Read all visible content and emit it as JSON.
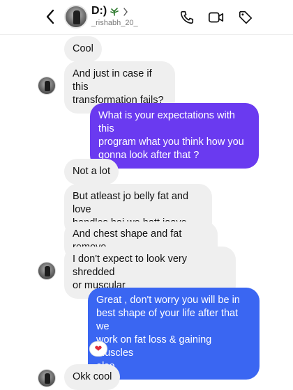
{
  "header": {
    "name": "D:)",
    "username": "_rishabh_20_"
  },
  "messages": [
    {
      "id": "m1",
      "from": "them",
      "text": "Cool"
    },
    {
      "id": "m2",
      "from": "them",
      "text": "And just in case if this\ntransformation fails?"
    },
    {
      "id": "m3",
      "from": "me",
      "text": "What is your expectations with this\nprogram what you think how you\ngonna look after that ?"
    },
    {
      "id": "m4",
      "from": "them",
      "text": "Not a lot"
    },
    {
      "id": "m5",
      "from": "them",
      "text": "But atleast jo belly fat and love\nhandles hai wo hatt jaaye"
    },
    {
      "id": "m6",
      "from": "them",
      "text": "And chest shape and fat remove"
    },
    {
      "id": "m7",
      "from": "them",
      "text": "I don't expect to look very shredded\nor muscular"
    },
    {
      "id": "m8",
      "from": "me",
      "text": "Great , don't worry you will be in\nbest shape of your life after that we\nwork on fat loss & gaining muscles\nalso"
    },
    {
      "id": "m9",
      "from": "them",
      "text": "Okk cool"
    }
  ],
  "reaction": {
    "emoji": "❤",
    "on_message": "m8"
  },
  "colors": {
    "incoming_bubble": "#efefef",
    "outgoing_purple": "#6a3af0",
    "outgoing_blue": "#3a66f2",
    "reaction_heart": "#e02a3a"
  },
  "icons": [
    "back-chevron-icon",
    "leaf-icon",
    "chevron-right-icon",
    "phone-icon",
    "video-camera-icon",
    "tag-icon"
  ]
}
